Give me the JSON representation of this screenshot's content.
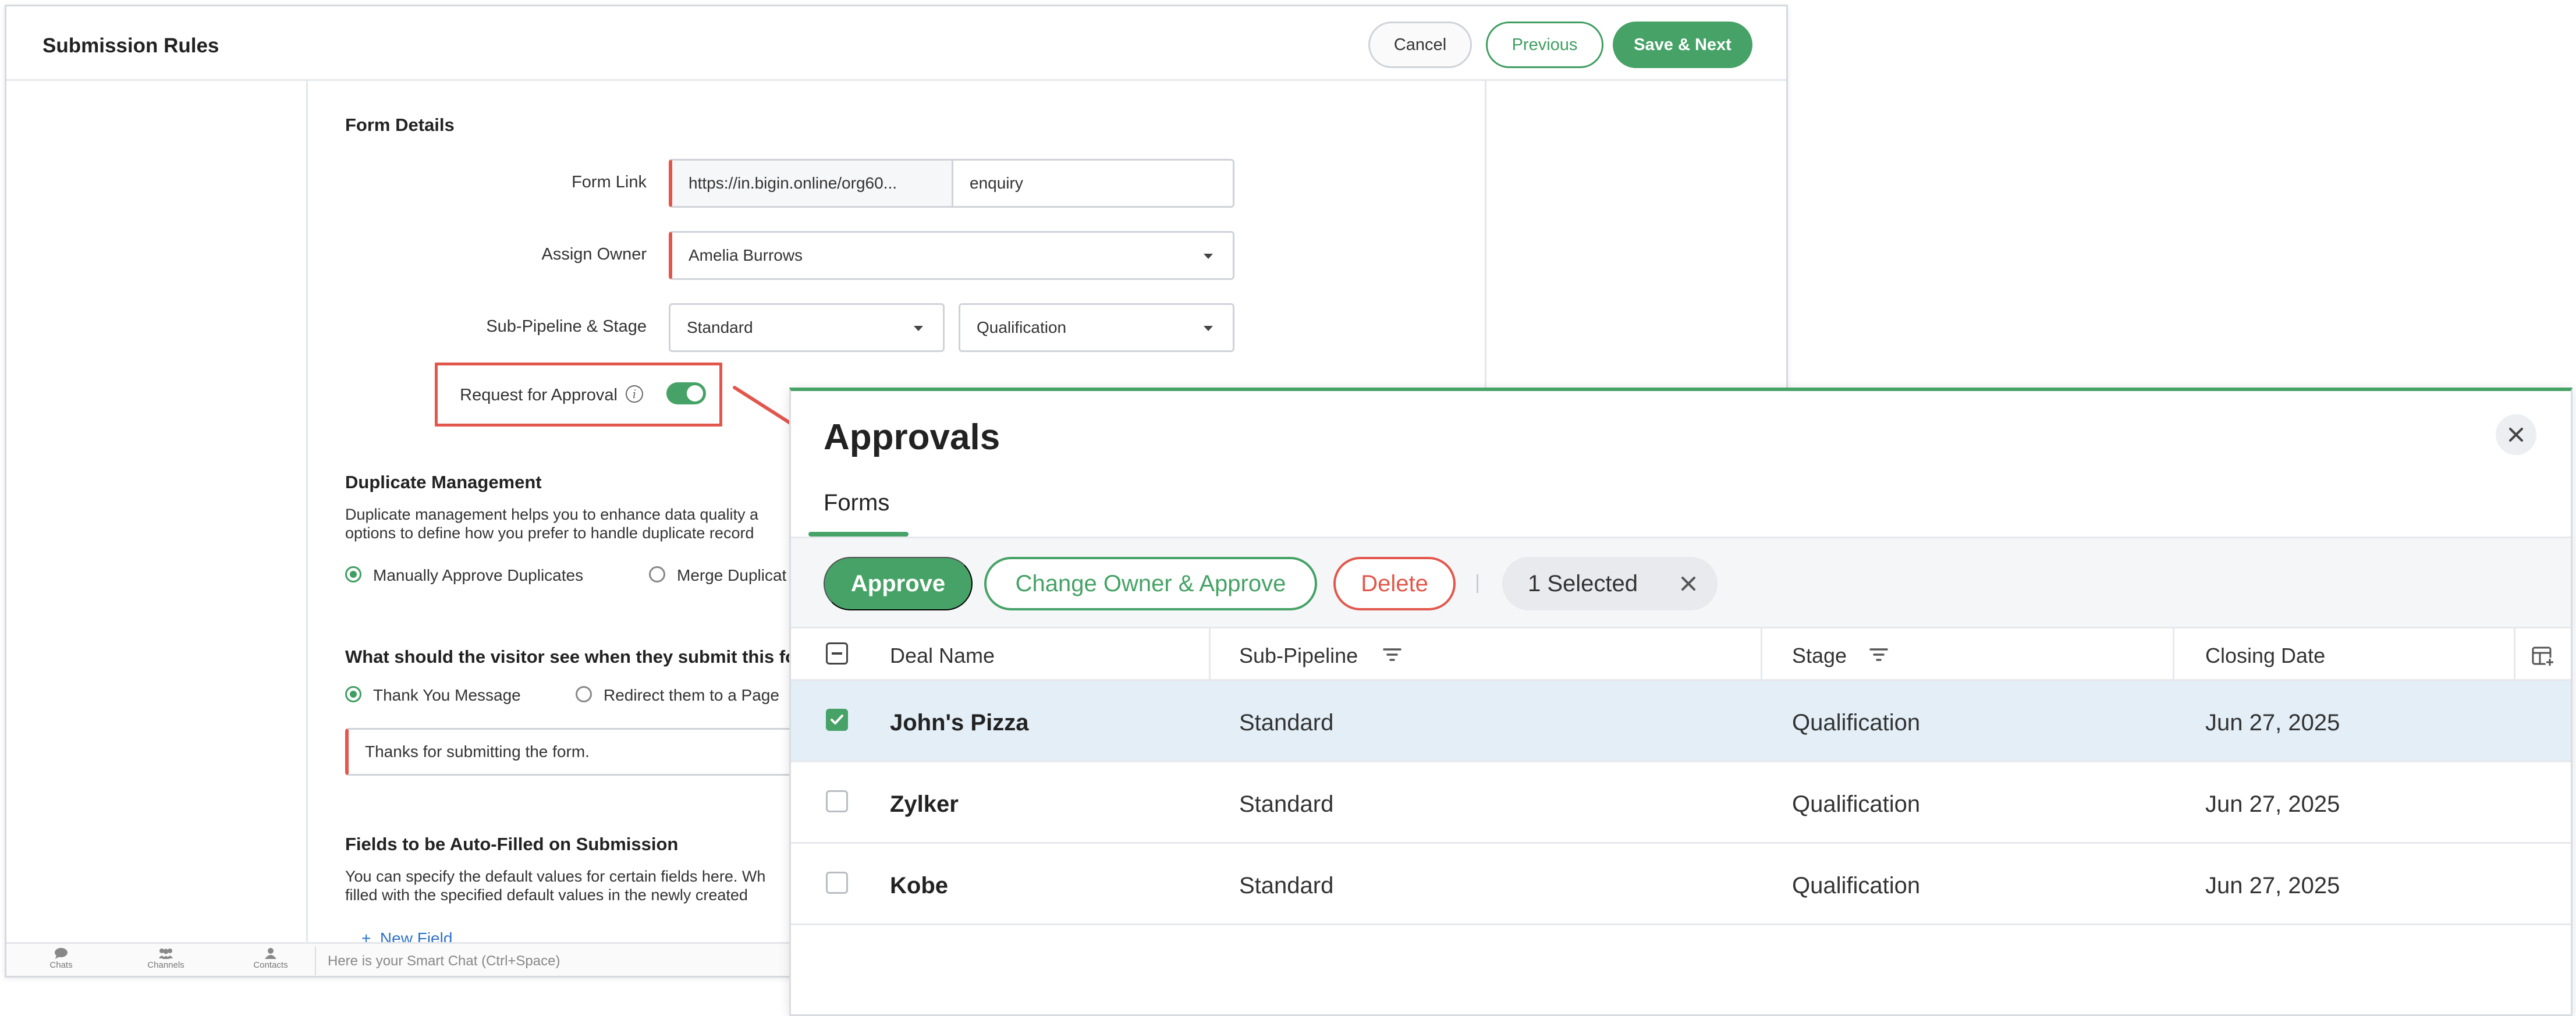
{
  "window": {
    "title": "Submission Rules",
    "buttons": {
      "cancel": "Cancel",
      "previous": "Previous",
      "save_next": "Save & Next"
    }
  },
  "form_details": {
    "heading": "Form Details",
    "form_link": {
      "label": "Form Link",
      "url": "https://in.bigin.online/org60...",
      "slug": "enquiry"
    },
    "assign_owner": {
      "label": "Assign Owner",
      "value": "Amelia Burrows"
    },
    "sub_pipeline_stage": {
      "label": "Sub-Pipeline & Stage",
      "pipeline": "Standard",
      "stage": "Qualification"
    },
    "request_for_approval": {
      "label": "Request for Approval",
      "enabled": true
    }
  },
  "duplicate_management": {
    "heading": "Duplicate Management",
    "desc_line1": "Duplicate management helps you to enhance data quality a",
    "desc_line2": "options to define how you prefer to handle duplicate record",
    "options": [
      "Manually Approve Duplicates",
      "Merge Duplicat"
    ],
    "selected": 0
  },
  "visitor_sees": {
    "heading": "What should the visitor see when they submit this for",
    "options": [
      "Thank You Message",
      "Redirect them to a Page"
    ],
    "selected": 0,
    "message": "Thanks for submitting the form."
  },
  "auto_fill": {
    "heading": "Fields to be Auto-Filled on Submission",
    "desc_line1": "You can specify the default values for certain fields here. Wh",
    "desc_line2": "filled with the specified default values in the newly created",
    "new_field": "New Field",
    "plus": "+"
  },
  "bottom_bar": {
    "items": [
      "Chats",
      "Channels",
      "Contacts"
    ],
    "chat_placeholder": "Here is your Smart Chat (Ctrl+Space)"
  },
  "approvals": {
    "title": "Approvals",
    "tab": "Forms",
    "actions": {
      "approve": "Approve",
      "change_owner": "Change Owner & Approve",
      "delete": "Delete"
    },
    "selection": "1 Selected",
    "columns": [
      "Deal Name",
      "Sub-Pipeline",
      "Stage",
      "Closing Date"
    ],
    "rows": [
      {
        "deal": "John's Pizza",
        "pipeline": "Standard",
        "stage": "Qualification",
        "closing": "Jun 27, 2025",
        "checked": true
      },
      {
        "deal": "Zylker",
        "pipeline": "Standard",
        "stage": "Qualification",
        "closing": "Jun 27, 2025",
        "checked": false
      },
      {
        "deal": "Kobe",
        "pipeline": "Standard",
        "stage": "Qualification",
        "closing": "Jun 27, 2025",
        "checked": false
      }
    ]
  },
  "colors": {
    "accent": "#46a266",
    "danger": "#e2574c",
    "link": "#2f73c9",
    "selected_row": "#e3eef7"
  },
  "icons": [
    "info-icon",
    "toggle-switch",
    "caret-down-icon",
    "chat-icon",
    "channels-icon",
    "contacts-icon",
    "close-icon",
    "filter-icon",
    "column-settings-icon",
    "checkbox",
    "arrow-annotation"
  ]
}
